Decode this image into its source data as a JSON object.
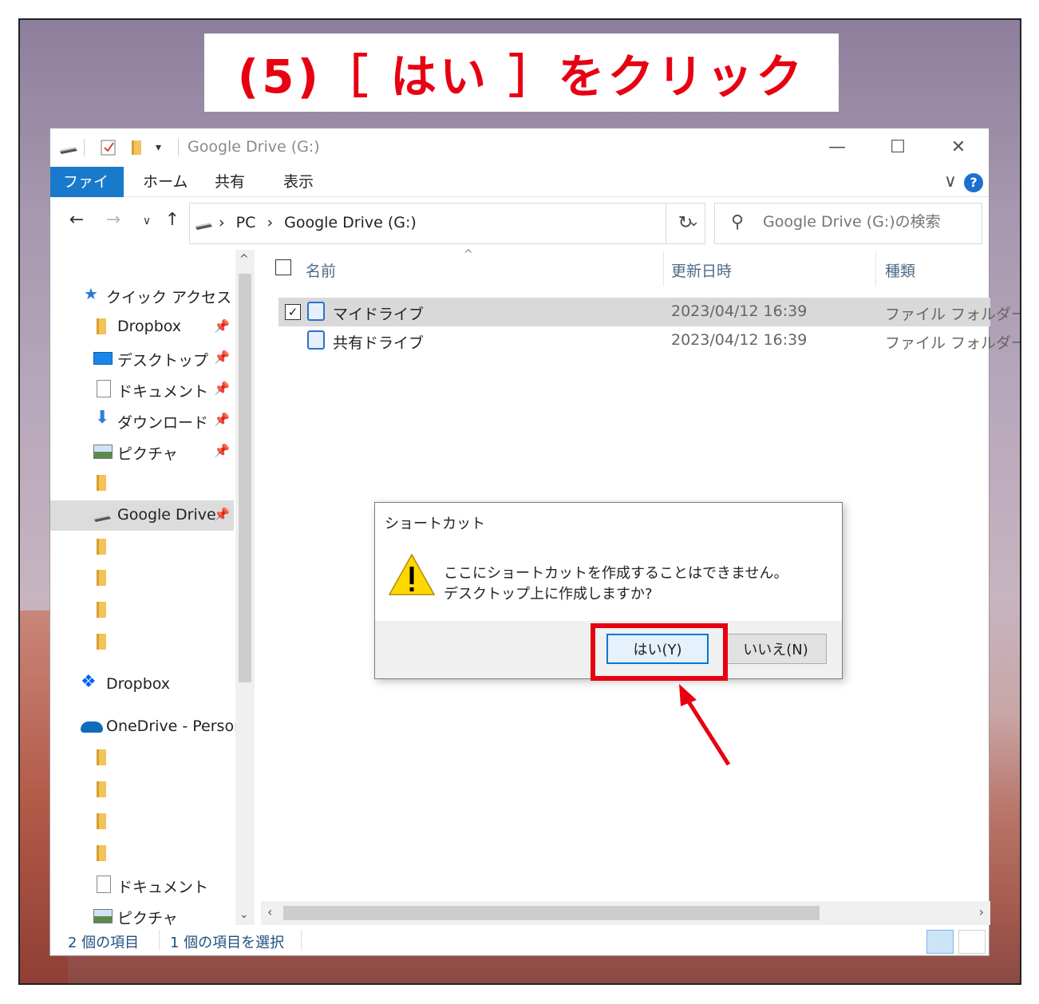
{
  "banner": {
    "text": "(5)［ はい ］をクリック"
  },
  "window": {
    "title": "Google Drive (G:)",
    "controls": {
      "minimize": "—",
      "maximize": "☐",
      "close": "✕"
    }
  },
  "ribbon": {
    "tabs": [
      "ファイル",
      "ホーム",
      "共有",
      "表示"
    ],
    "help": "?",
    "expand": "∨"
  },
  "nav": {
    "back": "←",
    "forward": "→",
    "recent": "∨",
    "up": "↑",
    "breadcrumb": [
      "PC",
      "Google Drive (G:)"
    ],
    "separator": "›",
    "refresh": "↻",
    "search_placeholder": "Google Drive (G:)の検索"
  },
  "sidebar": {
    "quick_access": "クイック アクセス",
    "pinned": [
      {
        "label": "Dropbox",
        "icon": "folder-icon"
      },
      {
        "label": "デスクトップ",
        "icon": "desktop-icon"
      },
      {
        "label": "ドキュメント",
        "icon": "document-icon"
      },
      {
        "label": "ダウンロード",
        "icon": "download-icon"
      },
      {
        "label": "ピクチャ",
        "icon": "pictures-icon"
      }
    ],
    "google_drive": "Google Drive",
    "dropbox": "Dropbox",
    "onedrive": "OneDrive - Persor",
    "documents": "ドキュメント",
    "pictures": "ピクチャ"
  },
  "content": {
    "columns": [
      "名前",
      "更新日時",
      "種類"
    ],
    "rows": [
      {
        "name": "マイドライブ",
        "date": "2023/04/12 16:39",
        "type": "ファイル フォルダー",
        "checked": "✓"
      },
      {
        "name": "共有ドライブ",
        "date": "2023/04/12 16:39",
        "type": "ファイル フォルダー",
        "checked": ""
      }
    ]
  },
  "status": {
    "count": "2 個の項目",
    "selected": "1 個の項目を選択"
  },
  "dialog": {
    "title": "ショートカット",
    "message_line1": "ここにショートカットを作成することはできません。",
    "message_line2": "デスクトップ上に作成しますか?",
    "yes": "はい(Y)",
    "no": "いいえ(N)"
  },
  "colors": {
    "accent": "#1979ca",
    "highlight": "#e60012",
    "banner_text": "#e60012"
  }
}
